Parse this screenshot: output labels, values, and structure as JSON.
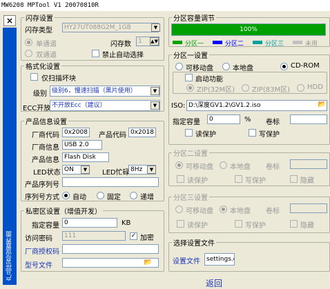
{
  "title": "MW6208 MPTool V1 20070810R",
  "close": "×",
  "sidebar": {
    "vertical_text": "产品信息设置界面"
  },
  "flash": {
    "legend": "闪存设置",
    "type_label": "闪存类型",
    "type_value": "HY27UT088G2M_1GB",
    "count_label": "闪存数",
    "count_value": "1",
    "single_channel": "单通道",
    "dual_channel": "双通道",
    "disable_auto": "禁止自动选择"
  },
  "format": {
    "legend": "格式化设置",
    "scan_bad": "仅扫描坏块",
    "level_label": "级别",
    "level_value": "级别6，慢速扫描（黑片使用）",
    "ecc_label": "ECC开放",
    "ecc_value": "不开放Ecc（建议）"
  },
  "product": {
    "legend": "产品信息设置",
    "vendor_code_label": "厂商代码",
    "vendor_code": "0x2008",
    "product_code_label": "产品代码",
    "product_code": "0x2018",
    "vendor_info_label": "厂商信息",
    "vendor_info": "USB 2.0",
    "product_info_label": "产品信息",
    "product_info": "Flash Disk",
    "led_state_label": "LED状态",
    "led_state": "ON",
    "led_blink_label": "LED忙碌",
    "led_blink": "8Hz",
    "serial_label": "产品序列号",
    "serial_value": "",
    "serial_mode_label": "序列号方式",
    "mode_auto": "自动",
    "mode_fixed": "固定",
    "mode_incr": "递增"
  },
  "private": {
    "legend": "私密区设置（增值开发）",
    "capacity_label": "指定容量",
    "capacity_value": "0",
    "capacity_unit": "KB",
    "password_label": "访问密码",
    "password_value": "111",
    "encrypt_label": "加密",
    "auth_label": "厂商授权码",
    "model_file_label": "型号文件"
  },
  "partition_capacity": {
    "legend": "分区容量调节",
    "percent_text": "100%",
    "percent": 100,
    "legend_items": [
      "分区一",
      "分区二",
      "分区三",
      "未用"
    ],
    "legend_colors": [
      "#00a000",
      "#0000ff",
      "#00a0a0",
      "#c0c0c0"
    ]
  },
  "part1": {
    "legend": "分区一设置",
    "removable": "可移动盘",
    "local": "本地盘",
    "cdrom": "CD-ROM",
    "boot": "启动功能",
    "zip32": "ZIP(32M区)",
    "zip83": "ZIP(83M区)",
    "hdd": "HDD",
    "iso_label": "ISO:",
    "iso_path": "D:\\深度GV1.2\\GV1.2.iso",
    "capacity_label": "指定容量",
    "capacity_value": "0",
    "capacity_unit": "%",
    "volume_label": "卷标",
    "volume_value": "",
    "readonly": "读保护",
    "writeprotect": "写保护"
  },
  "part2": {
    "legend": "分区二设置",
    "removable": "可移动盘",
    "local": "本地盘",
    "volume_label": "卷标",
    "readonly": "读保护",
    "writeprotect": "写保护",
    "hidden": "隐藏"
  },
  "part3": {
    "legend": "分区三设置",
    "removable": "可移动盘",
    "local": "本地盘",
    "volume_label": "卷标",
    "readonly": "读保护",
    "writeprotect": "写保护",
    "hidden": "隐藏"
  },
  "config": {
    "legend": "选择设置文件",
    "file_label": "设置文件",
    "file_value": "settings.c"
  },
  "bottom_link": "返回"
}
